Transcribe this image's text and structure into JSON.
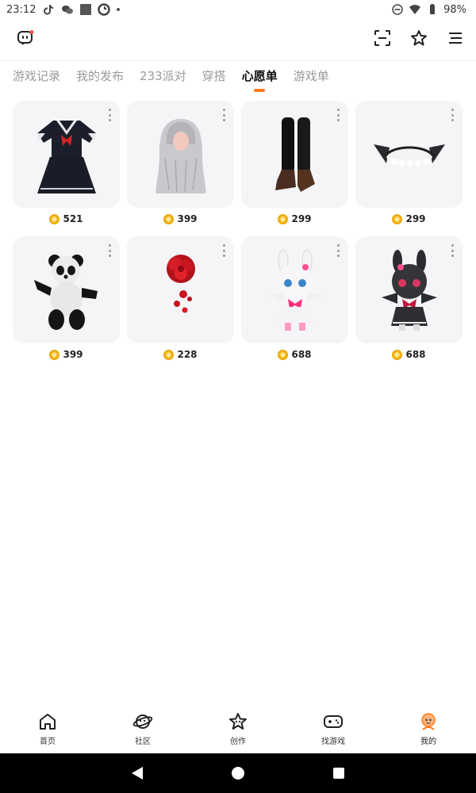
{
  "status_bar": {
    "time": "23:12",
    "battery": "98%"
  },
  "tabs": [
    {
      "label": "游戏记录",
      "active": false
    },
    {
      "label": "我的发布",
      "active": false
    },
    {
      "label": "233派对",
      "active": false
    },
    {
      "label": "穿搭",
      "active": false
    },
    {
      "label": "心愿单",
      "active": true
    },
    {
      "label": "游戏单",
      "active": false
    }
  ],
  "items": [
    {
      "icon": "sailor-dress-icon",
      "price": "521"
    },
    {
      "icon": "silver-wig-icon",
      "price": "399"
    },
    {
      "icon": "black-boots-icon",
      "price": "299"
    },
    {
      "icon": "maid-headband-icon",
      "price": "299"
    },
    {
      "icon": "panda-plush-icon",
      "price": "399"
    },
    {
      "icon": "red-rose-icon",
      "price": "228"
    },
    {
      "icon": "white-bunny-doll-icon",
      "price": "688"
    },
    {
      "icon": "black-bunny-doll-icon",
      "price": "688"
    }
  ],
  "bottom_nav": [
    {
      "label": "首页",
      "icon": "home-icon"
    },
    {
      "label": "社区",
      "icon": "planet-icon"
    },
    {
      "label": "创作",
      "icon": "star-icon"
    },
    {
      "label": "找游戏",
      "icon": "gamepad-icon"
    },
    {
      "label": "我的",
      "icon": "profile-avatar-icon"
    }
  ],
  "colors": {
    "accent": "#ff7a1a",
    "coin": "#f6c021",
    "card_bg": "#f5f5f7"
  }
}
